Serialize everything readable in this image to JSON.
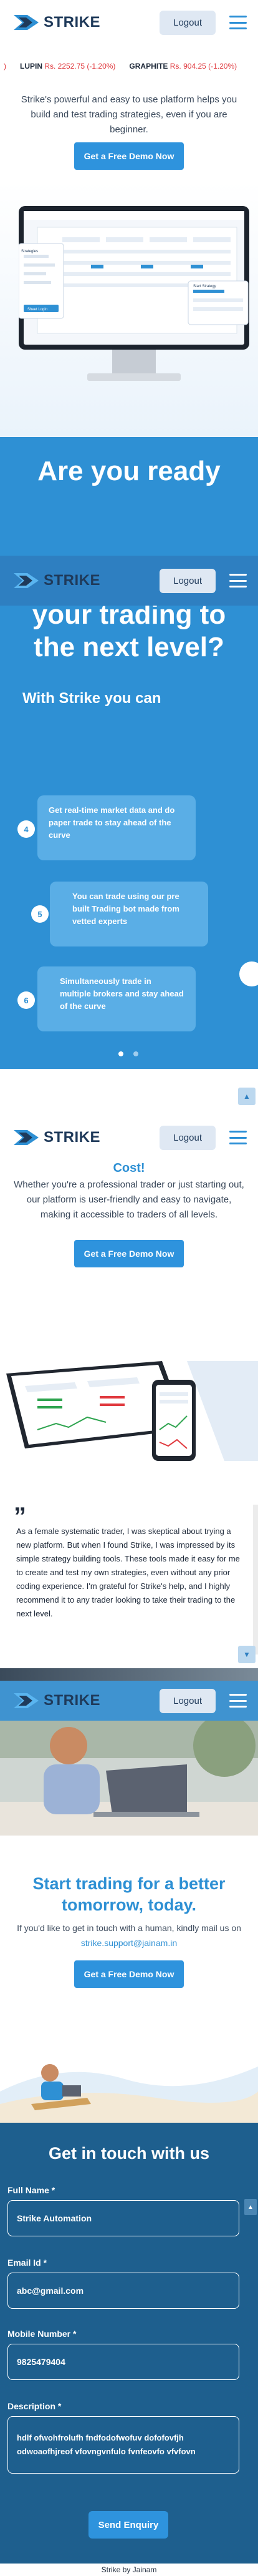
{
  "brand": {
    "name": "STRIKE"
  },
  "header": {
    "logout_label": "Logout"
  },
  "ticker": [
    {
      "symbol": "LUPIN",
      "value": "Rs. 2252.75 (-1.20%)"
    },
    {
      "symbol": "GRAPHITE",
      "value": "Rs. 904.25 (-1.20%)"
    }
  ],
  "hero": {
    "text": "Strike's powerful and easy to use platform helps you build and test trading strategies, even if you are beginner.",
    "cta_label": "Get a Free Demo Now"
  },
  "monitor": {
    "card_title": "Strategies",
    "card_button": "Sheet Login",
    "panel_title": "Start Strategy"
  },
  "ready": {
    "title_lines": [
      "Are you ready",
      "your trading to",
      "the next level?"
    ],
    "subtitle": "With Strike you can",
    "features": [
      {
        "num": "4",
        "text": "Get real-time market data and do paper trade to stay ahead of the curve"
      },
      {
        "num": "5",
        "text": "You can trade using our pre built Trading bot made from vetted experts"
      },
      {
        "num": "6",
        "text": "Simultaneously trade in multiple brokers and stay ahead of the curve"
      }
    ]
  },
  "cost": {
    "heading_fragment": "Cost!",
    "text": "Whether you're a professional trader or just starting out, our platform is user-friendly and easy to navigate, making it accessible to traders of all levels.",
    "cta_label": "Get a Free Demo Now"
  },
  "testimonial": {
    "quote_mark": "”",
    "text": "As a female systematic trader, I was skeptical about trying a new platform. But when I found Strike, I was impressed by its simple strategy building tools. These tools made it easy for me to create and test my own strategies, even without any prior coding experience. I'm grateful for Strike's help, and I highly recommend it to any trader looking to take their trading to the next level."
  },
  "start": {
    "title_lines": [
      "Start trading for a better",
      "tomorrow, today."
    ],
    "text": "If you'd like to get in touch with a human, kindly mail us on",
    "email": "strike.support@jainam.in",
    "cta_label": "Get a Free Demo Now"
  },
  "contact": {
    "title": "Get in touch with us",
    "full_name_label": "Full Name *",
    "full_name_value": "Strike Automation",
    "email_label": "Email Id *",
    "email_value": "abc@gmail.com",
    "mobile_label": "Mobile Number *",
    "mobile_value": "9825479404",
    "description_label": "Description *",
    "description_value": "hdlf ofwohfrolufh fndfodofwofuv dofofovfjh odwoaofhjreof vfovngvnfulo fvnfeovfo vfvfovn",
    "submit_label": "Send Enquiry"
  },
  "footer": {
    "text": "Strike by Jainam"
  },
  "colors": {
    "primary": "#2e90d4",
    "navy": "#1f3a5a",
    "form_bg": "#1e5f8e",
    "negative": "#e0393e"
  }
}
